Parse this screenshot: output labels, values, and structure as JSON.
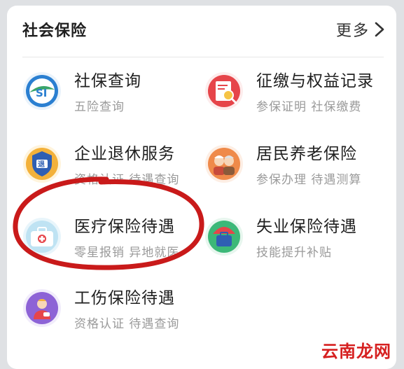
{
  "header": {
    "title": "社会保险",
    "more_label": "更多"
  },
  "items": [
    {
      "title": "社保查询",
      "subtitle": "五险查询",
      "icon": "si-logo-icon"
    },
    {
      "title": "征缴与权益记录",
      "subtitle": "参保证明 社保缴费",
      "icon": "record-search-icon"
    },
    {
      "title": "企业退休服务",
      "subtitle": "资格认证 待遇查询",
      "icon": "retire-badge-icon"
    },
    {
      "title": "居民养老保险",
      "subtitle": "参保办理 待遇测算",
      "icon": "elderly-couple-icon"
    },
    {
      "title": "医疗保险待遇",
      "subtitle": "零星报销 异地就医",
      "icon": "medical-kit-icon"
    },
    {
      "title": "失业保险待遇",
      "subtitle": "技能提升补贴",
      "icon": "umbrella-bag-icon"
    },
    {
      "title": "工伤保险待遇",
      "subtitle": "资格认证 待遇查询",
      "icon": "injured-worker-icon"
    }
  ],
  "watermark": "云南龙网",
  "colors": {
    "accent_red": "#c91a1a",
    "title": "#1f1f1f",
    "subtitle": "#9a9a9a"
  }
}
